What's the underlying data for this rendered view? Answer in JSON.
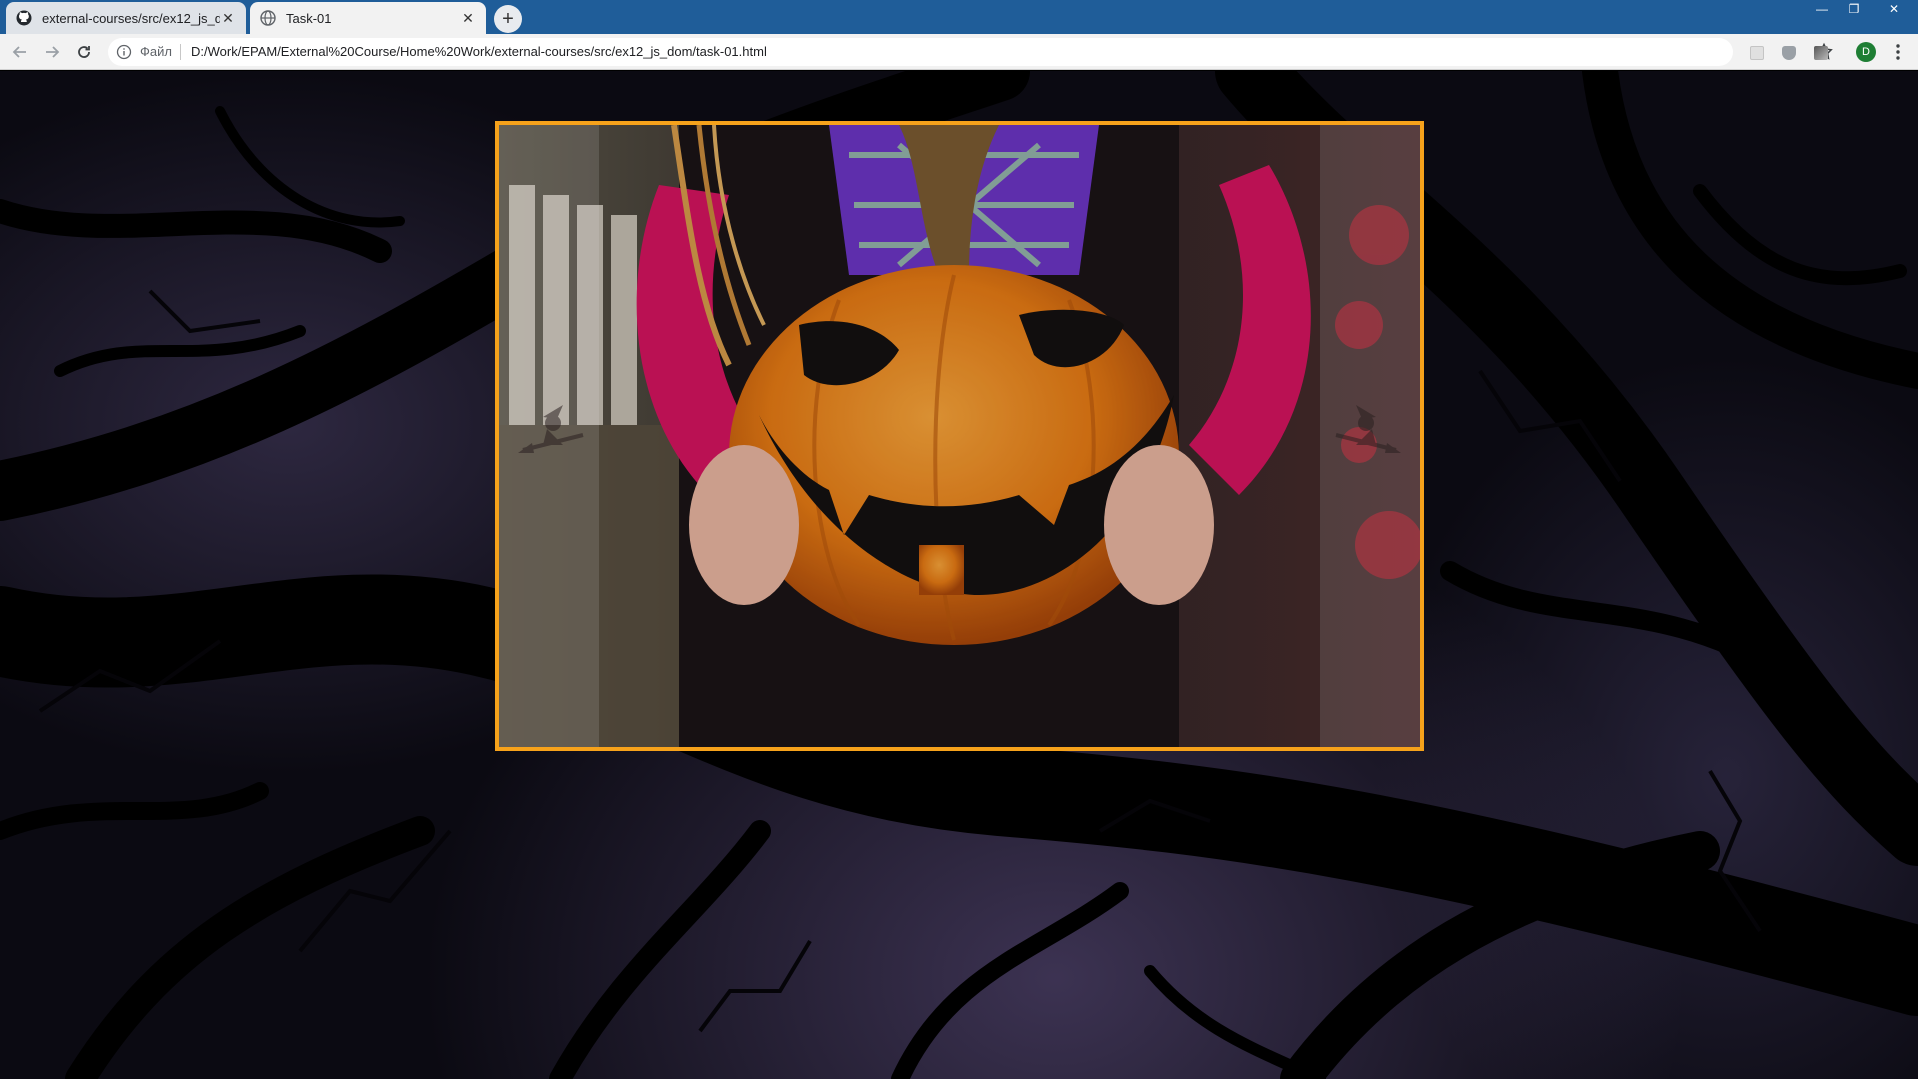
{
  "browser": {
    "tabs": [
      {
        "label": "external-courses/src/ex12_js_dom",
        "icon": "github-icon",
        "active": false
      },
      {
        "label": "Task-01",
        "icon": "globe-icon",
        "active": true
      }
    ],
    "address_bar": {
      "scheme_label": "Файл",
      "url": "D:/Work/EPAM/External%20Course/Home%20Work/external-courses/src/ex12_js_dom/task-01.html"
    },
    "profile_initial": "D",
    "accent_color": "#1f5d99"
  },
  "page": {
    "frame_border_color": "#f6a21b",
    "photo_subject": "jack-o-lantern pumpkin held by child in costume",
    "background_subject": "dark tree branches against purple night sky"
  }
}
